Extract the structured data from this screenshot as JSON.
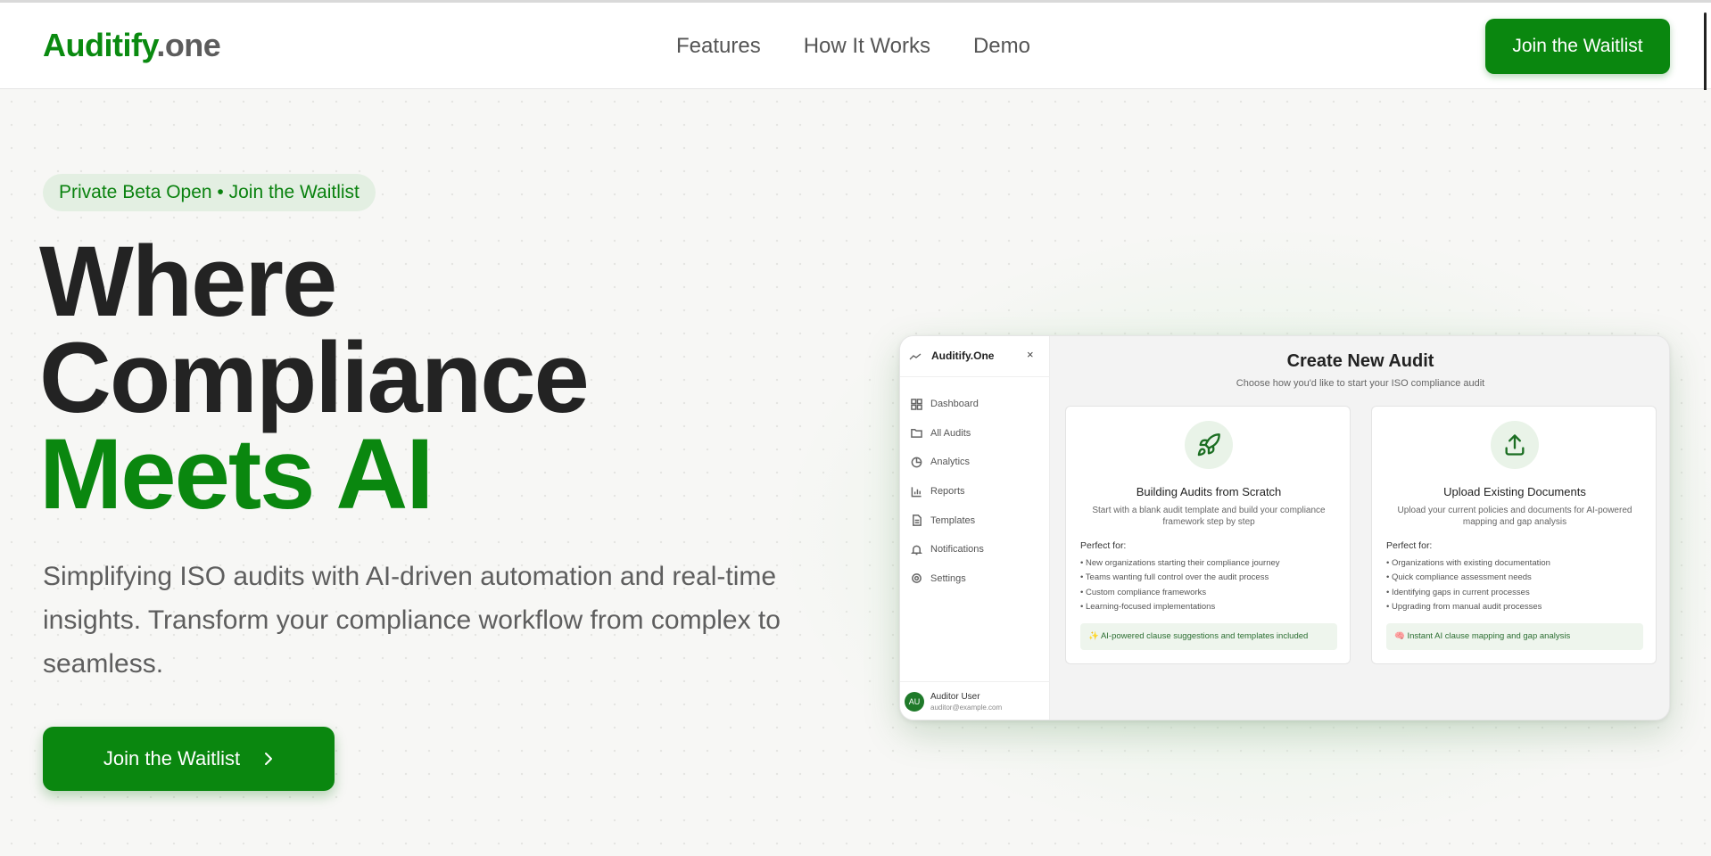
{
  "header": {
    "logo_brand": "Auditify",
    "logo_tld": ".one",
    "nav": [
      "Features",
      "How It Works",
      "Demo"
    ],
    "cta_label": "Join the Waitlist"
  },
  "hero": {
    "badge": "Private Beta Open • Join the Waitlist",
    "headline_line1": "Where",
    "headline_line2": "Compliance",
    "headline_line3": "Meets AI",
    "subtitle": "Simplifying ISO audits with AI-driven automation and real-time insights. Transform your compliance workflow from complex to seamless.",
    "cta_label": "Join the Waitlist",
    "cta_icon": "chevron-right-icon"
  },
  "mock": {
    "sidebar": {
      "title": "Auditify.One",
      "close_glyph": "×",
      "items": [
        {
          "label": "Dashboard",
          "icon": "grid-icon"
        },
        {
          "label": "All Audits",
          "icon": "folder-icon"
        },
        {
          "label": "Analytics",
          "icon": "pie-chart-icon"
        },
        {
          "label": "Reports",
          "icon": "bar-chart-icon"
        },
        {
          "label": "Templates",
          "icon": "file-icon"
        },
        {
          "label": "Notifications",
          "icon": "bell-icon"
        },
        {
          "label": "Settings",
          "icon": "gear-icon"
        }
      ],
      "user": {
        "initials": "AU",
        "name": "Auditor User",
        "email": "auditor@example.com"
      }
    },
    "main": {
      "title": "Create New Audit",
      "subtitle": "Choose how you'd like to start your ISO compliance audit",
      "cards": [
        {
          "icon": "rocket-icon",
          "title": "Building Audits from Scratch",
          "description": "Start with a blank audit template and build your compliance framework step by step",
          "perfect_for": "Perfect for:",
          "items": [
            "• New organizations starting their compliance journey",
            "• Teams wanting full control over the audit process",
            "• Custom compliance frameworks",
            "• Learning-focused implementations"
          ],
          "note": "✨ AI-powered clause suggestions and templates included"
        },
        {
          "icon": "upload-icon",
          "title": "Upload Existing Documents",
          "description": "Upload your current policies and documents for AI-powered mapping and gap analysis",
          "perfect_for": "Perfect for:",
          "items": [
            "• Organizations with existing documentation",
            "• Quick compliance assessment needs",
            "• Identifying gaps in current processes",
            "• Upgrading from manual audit processes"
          ],
          "note": "🧠 Instant AI clause mapping and gap analysis"
        }
      ]
    }
  },
  "colors": {
    "brand_green": "#0a870f",
    "badge_bg": "#e3efe2",
    "text_dark": "#232323",
    "text_muted": "#5e5e5e"
  }
}
